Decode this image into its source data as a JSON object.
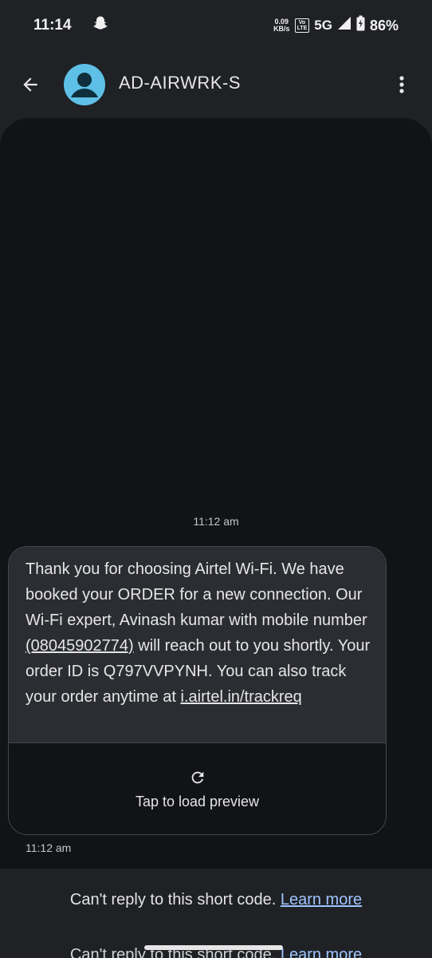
{
  "status_bar": {
    "time": "11:14",
    "net_speed_value": "0.09",
    "net_speed_unit": "KB/s",
    "volte_top": "Vo",
    "volte_bottom": "LTE",
    "network": "5G",
    "battery": "86%"
  },
  "app_bar": {
    "contact_name": "AD-AIRWRK-S"
  },
  "conversation": {
    "timestamp_top": "11:12 am",
    "message": {
      "part1": "Thank you for choosing Airtel Wi-Fi. We have booked your ORDER for a new connection. Our Wi-Fi expert, Avinash kumar with mobile number ",
      "phone": "(08045902774)",
      "part2": " will reach out to you shortly. Your order ID is Q797VVPYNH. You can also track your order anytime at ",
      "url": "i.airtel.in/trackreq"
    },
    "preview_label": "Tap to load preview",
    "timestamp_bottom": "11:12 am"
  },
  "footer": {
    "cant_reply": "Can't reply to this short code.",
    "learn_more": "Learn more"
  },
  "colors": {
    "avatar": "#5ec0e6",
    "link": "#9fc4ff",
    "background": "#1f2125",
    "conversation_bg": "#121316",
    "bubble_bg": "#2b2d32"
  }
}
